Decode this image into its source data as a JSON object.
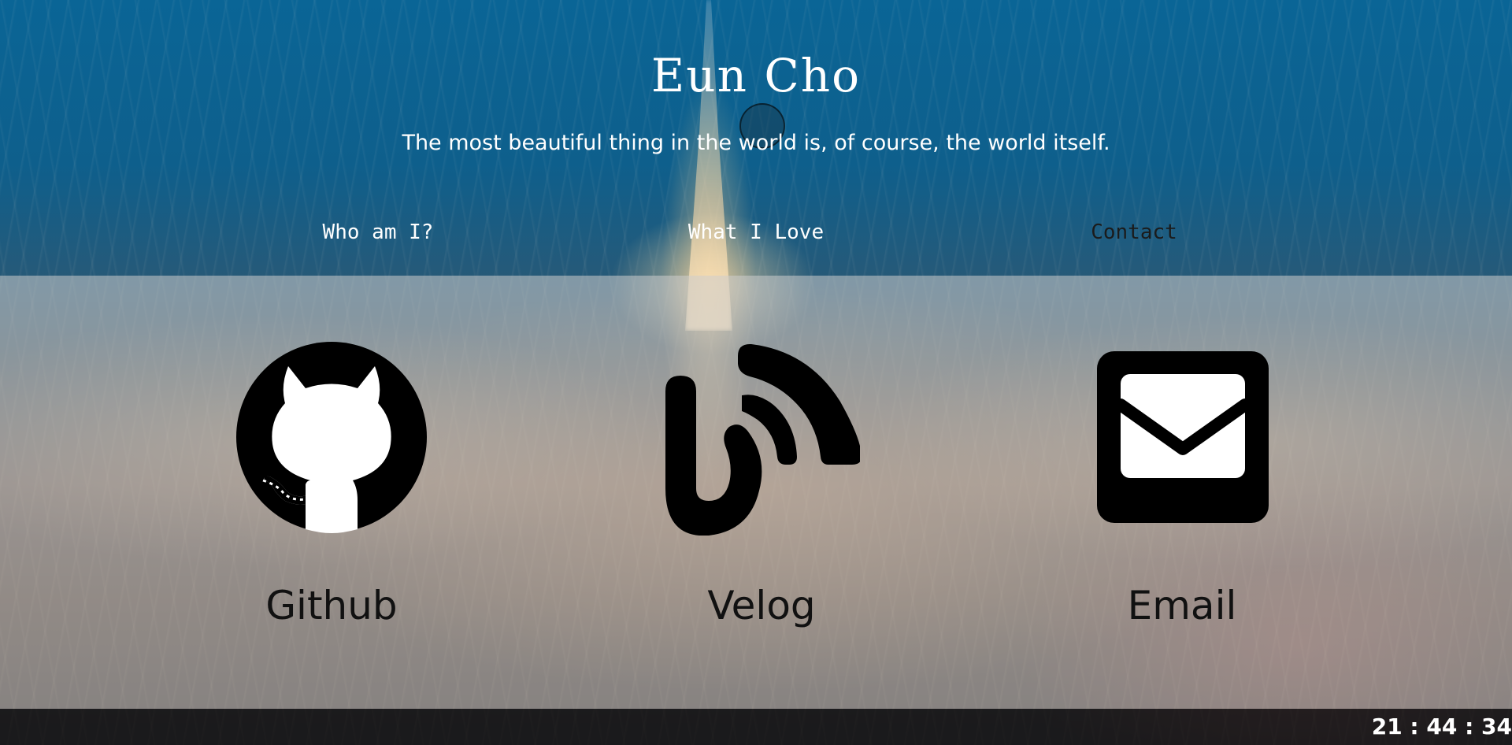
{
  "header": {
    "title": "Eun Cho",
    "tagline": "The most beautiful thing in the world is, of course, the world itself."
  },
  "nav": {
    "items": [
      {
        "label": "Who am I?"
      },
      {
        "label": "What I Love"
      },
      {
        "label": "Contact",
        "active": true
      }
    ]
  },
  "contact": {
    "cards": [
      {
        "label": "Github",
        "icon": "github-icon"
      },
      {
        "label": "Velog",
        "icon": "velog-icon"
      },
      {
        "label": "Email",
        "icon": "email-icon"
      }
    ]
  },
  "footer": {
    "clock": "21 : 44 : 34"
  },
  "colors": {
    "sky": "#0a6596",
    "panel_overlay": "#cdcdcd",
    "active_nav": "#1b1b1b",
    "text_light": "#ffffff",
    "text_dark": "#111111"
  }
}
